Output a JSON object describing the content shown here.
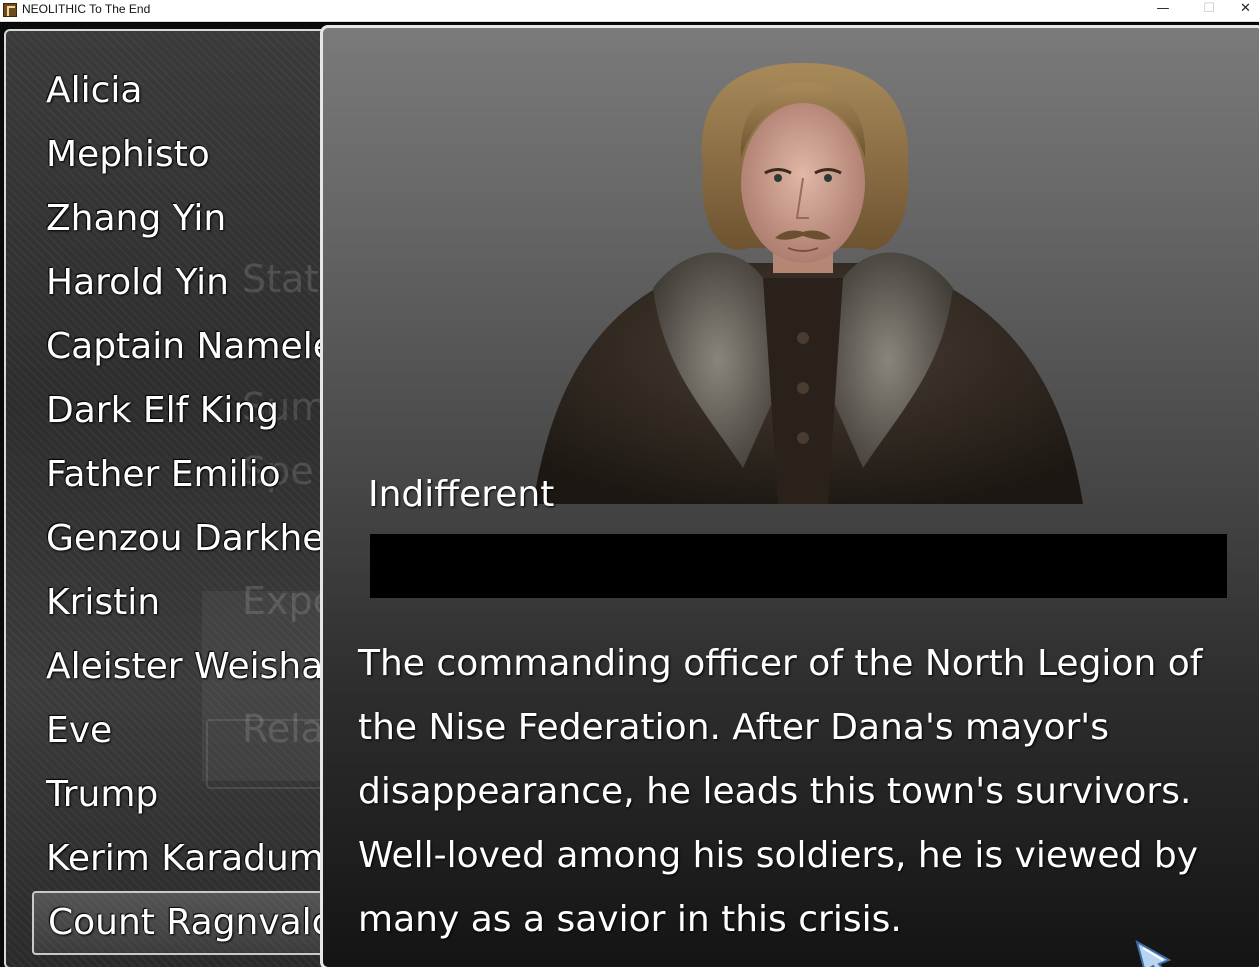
{
  "window": {
    "title": "NEOLITHIC To The End",
    "min_glyph": "—",
    "max_glyph": "☐",
    "close_glyph": "✕"
  },
  "background_ui": {
    "ghost_labels": [
      "Stat",
      "Sum",
      "Spe",
      "Expe",
      "Rela"
    ]
  },
  "characters": [
    "Alicia",
    "Mephisto",
    "Zhang Yin",
    "Harold Yin",
    "Captain Namele",
    "Dark Elf King",
    "Father Emilio",
    "Genzou Darkhe",
    "Kristin",
    "Aleister Weisha",
    "Eve",
    "Trump",
    "Kerim Karadum",
    "Count Ragnvalc"
  ],
  "selected_index": 13,
  "detail": {
    "portrait_icon": "character-portrait",
    "mood": "Indifferent",
    "affinity_fraction": 0,
    "description_lines": [
      "The commanding officer of the North Legion of",
      "the Nise Federation. After Dana's mayor's",
      "disappearance, he leads this town's survivors.",
      "Well-loved among his soldiers, he is viewed by",
      "many as a savior in this crisis."
    ]
  },
  "colors": {
    "affinity_bar": "#c7383b",
    "text": "#ffffff"
  }
}
